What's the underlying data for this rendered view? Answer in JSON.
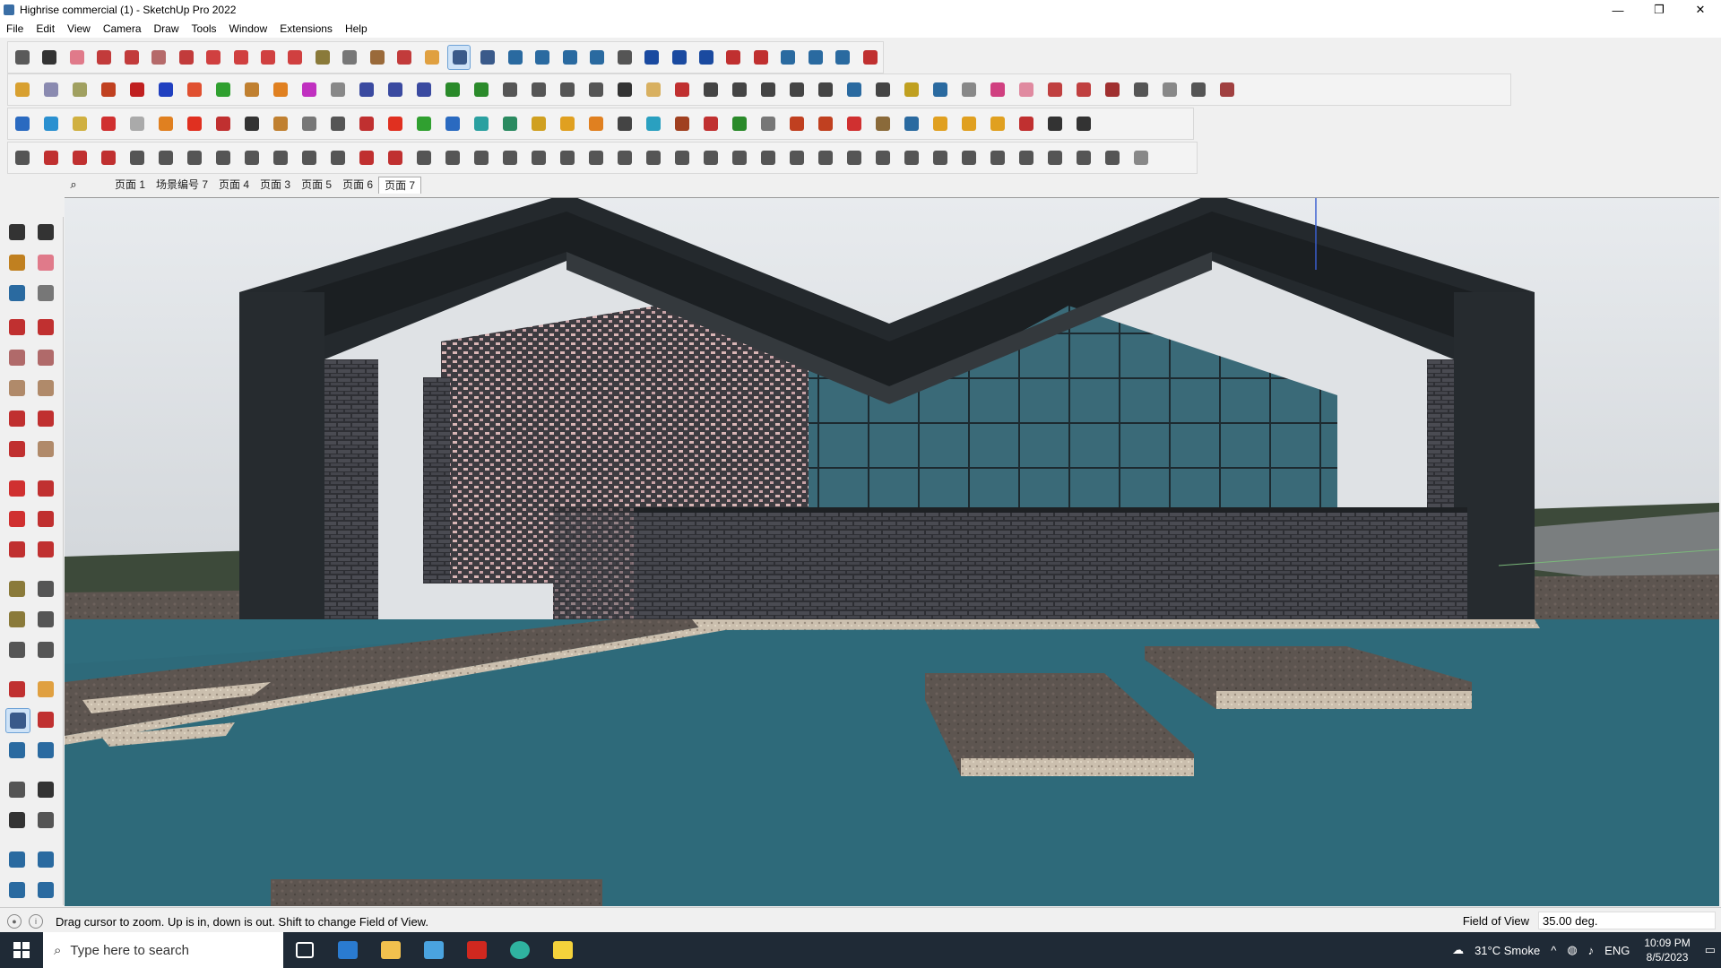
{
  "window": {
    "title": "Highrise commercial (1) - SketchUp Pro 2022",
    "minimize": "—",
    "restore": "❐",
    "close": "✕"
  },
  "menu": [
    "File",
    "Edit",
    "View",
    "Camera",
    "Draw",
    "Tools",
    "Window",
    "Extensions",
    "Help"
  ],
  "scenes": {
    "tabs": [
      "页面 1",
      "场景编号 7",
      "页面 4",
      "页面 3",
      "页面 5",
      "页面 6",
      "页面 7"
    ],
    "active": "页面 7"
  },
  "status": {
    "message": "Drag cursor to zoom.  Up is in, down is out. Shift to change Field of View.",
    "measure_label": "Field of View",
    "measure_value": "35.00 deg."
  },
  "taskbar": {
    "search_placeholder": "Type here to search",
    "weather": "31°C  Smoke",
    "language": "ENG",
    "time": "10:09 PM",
    "date": "8/5/2023"
  },
  "colors": {
    "sky": "#d9dde1",
    "roof": "#2a3035",
    "water": "#2f6d7d",
    "brick": "#3a3b40",
    "glass": "#2e5d6b",
    "accent_blue": "#6ea2d6"
  },
  "icons": {
    "active_tool": "zoom-icon"
  }
}
